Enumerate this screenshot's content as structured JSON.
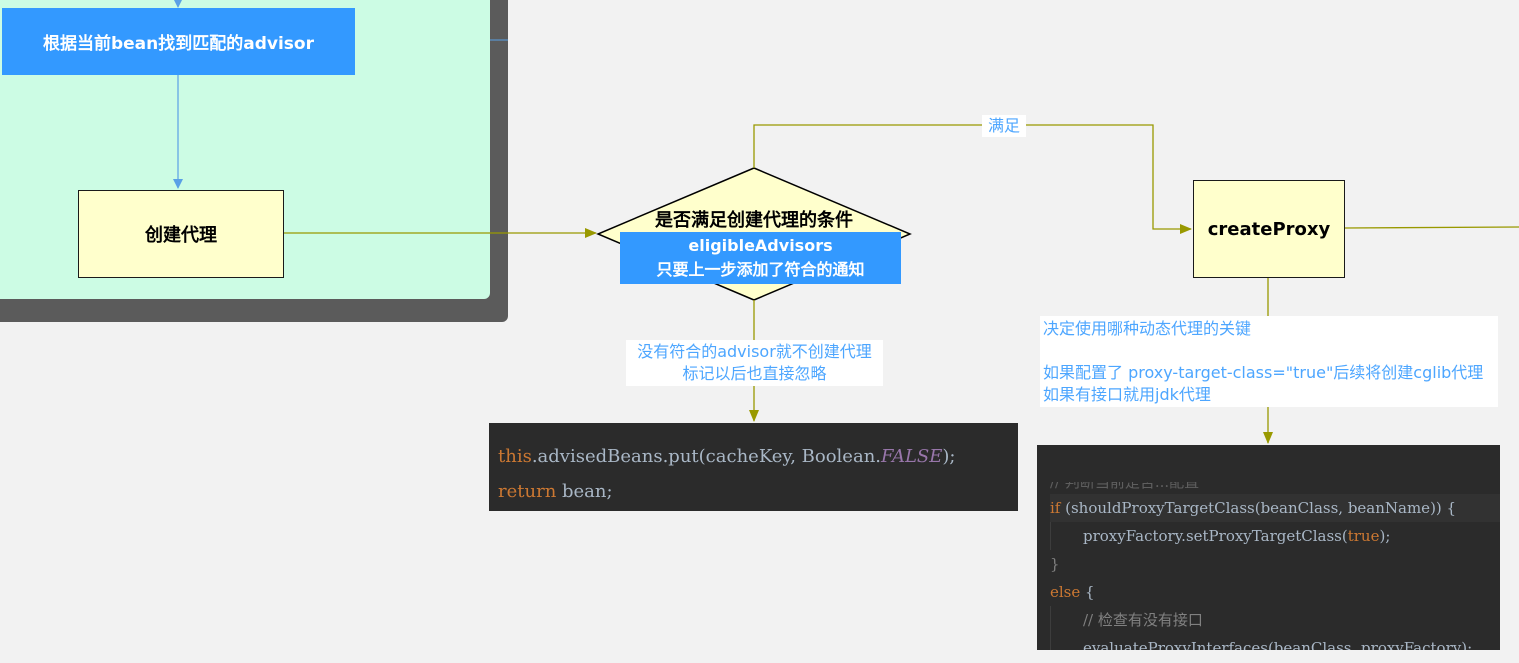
{
  "nodes": {
    "match_advisor": "根据当前bean找到匹配的advisor",
    "create_proxy_cn": "创建代理",
    "decision": "是否满足创建代理的条件",
    "decision_note_line1": "eligibleAdvisors",
    "decision_note_line2": "只要上一步添加了符合的通知",
    "create_proxy": "createProxy"
  },
  "edge_labels": {
    "satisfy": "满足",
    "no_advisor_line1": "没有符合的advisor就不创建代理",
    "no_advisor_line2": "标记以后也直接忽略",
    "key_line1": "决定使用哪种动态代理的关键",
    "key_line3": "如果配置了 proxy-target-class=\"true\"后续将创建cglib代理",
    "key_line4": "如果有接口就用jdk代理"
  },
  "code_false": {
    "l1_this": "this",
    "l1_mid": ".advisedBeans.put(cacheKey, Boolean.",
    "l1_const": "FALSE",
    "l1_end": ");",
    "l2_kw": "return",
    "l2_rest": " bean;"
  },
  "code_proxy": {
    "l0": "// 判断当前是否...配置",
    "l1_kw": "if",
    "l1_rest": " (shouldProxyTargetClass(beanClass, beanName)) {",
    "l2_mid": "proxyFactory.setProxyTargetClass(",
    "l2_true": "true",
    "l2_end": ");",
    "l3": "}",
    "l4_kw": "else",
    "l4_rest": " {",
    "l5_comment": "// 检查有没有接口",
    "l6": "evaluateProxyInterfaces(beanClass, proxyFactory);",
    "l7": "}"
  },
  "colors": {
    "flow_blue": "#3399ff",
    "flow_olive": "#999900",
    "node_yellow": "#ffffcc",
    "group_green": "#ccfce4"
  }
}
